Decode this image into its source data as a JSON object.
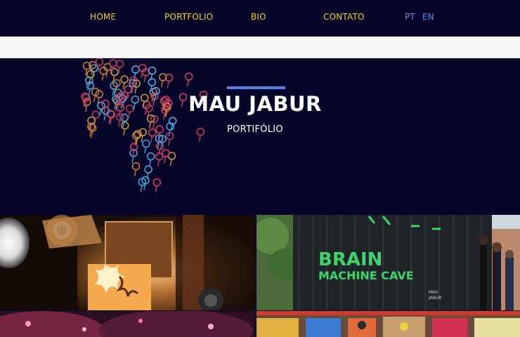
{
  "nav": {
    "items": [
      {
        "label": "HOME"
      },
      {
        "label": "PORTFOLIO"
      },
      {
        "label": "BIO"
      },
      {
        "label": "CONTATO"
      }
    ],
    "languages": [
      "PT",
      "EN"
    ]
  },
  "hero": {
    "title": "MAU JABUR",
    "subtitle": "PORTIFÓLIO"
  },
  "gallery": {
    "tile2_sign": {
      "line1": "BRAIN",
      "line2": "MACHINE CAVE",
      "small1": "MAU",
      "small2": "JABUR"
    }
  },
  "colors": {
    "background": "#05052a",
    "nav_text": "#f2d21a",
    "language_text": "#5b8fe6",
    "accent": "#4d86e8",
    "sign_green": "#39d66b"
  }
}
